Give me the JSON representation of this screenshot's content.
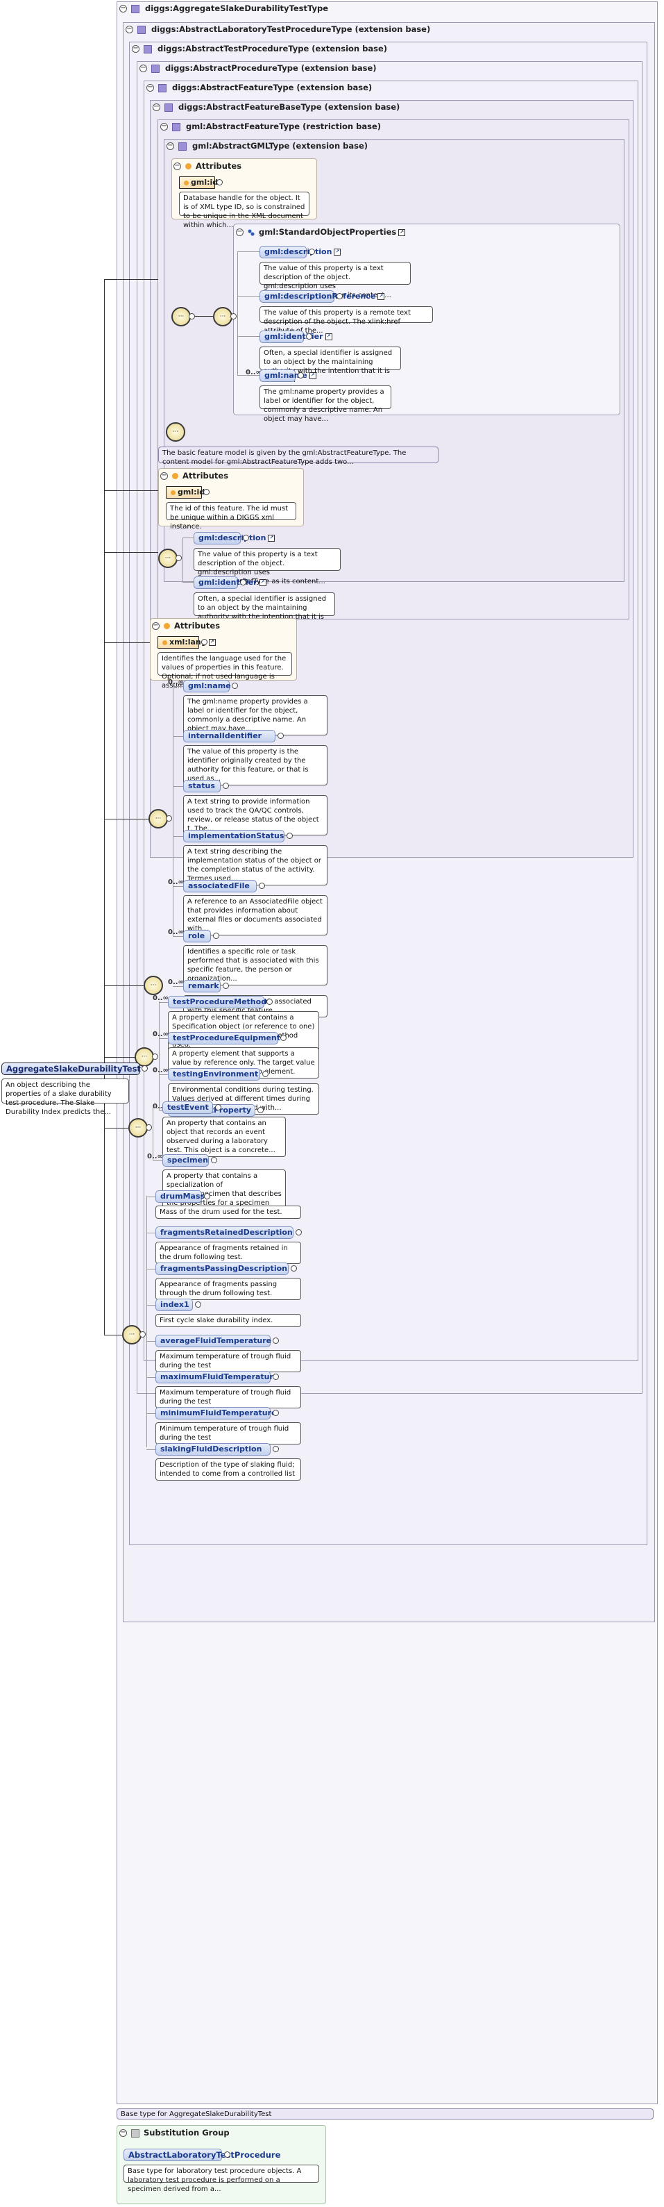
{
  "types": {
    "root": "diggs:AggregateSlakeDurabilityTestType",
    "alt": "diggs:AbstractLaboratoryTestProcedureType (extension base)",
    "atp": "diggs:AbstractTestProcedureType (extension base)",
    "ap": "diggs:AbstractProcedureType (extension base)",
    "af": "diggs:AbstractFeatureType (extension base)",
    "afb": "diggs:AbstractFeatureBaseType (extension base)",
    "gaf": "gml:AbstractFeatureType (restriction base)",
    "gml": "gml:AbstractGMLType (extension base)"
  },
  "attributes_label": "Attributes",
  "gml_attrs": {
    "gml_id": "gml:id",
    "gml_id_desc": "Database handle for the object. It is of XML type ID, so is constrained to be unique in the XML document within which..."
  },
  "standard_props": {
    "group": "gml:StandardObjectProperties",
    "items": [
      {
        "name": "gml:description",
        "desc": "The value of this property is a text description of the object. gml:description uses gml:StringOrRefType as its content..."
      },
      {
        "name": "gml:descriptionReference",
        "desc": "The value of this property is a remote text description of the object. The xlink:href attribute of the..."
      },
      {
        "name": "gml:identifier",
        "desc": "Often, a special identifier is assigned to an object by the maintaining authority with the intention that it is used in..."
      },
      {
        "name": "gml:name",
        "card": "0..∞",
        "desc": "The gml:name property provides a label or identifier for the object, commonly a descriptive name. An object may have..."
      }
    ]
  },
  "gaf_desc": "The basic feature model is given by the gml:AbstractFeatureType. The content model for gml:AbstractFeatureType adds two...",
  "afb_attrs": {
    "gml_id": "gml:id",
    "gml_id_desc": "The id of this feature. The id must be unique within a DIGGS xml instance."
  },
  "afb_elems": [
    {
      "name": "gml:description",
      "desc": "The value of this property is a text description of the object. gml:description uses gml:StringOrRefType as its content..."
    },
    {
      "name": "gml:identifier",
      "desc": "Often, a special identifier is assigned to an object by the maintaining authority with the intention that it is used in..."
    }
  ],
  "af_attrs": {
    "xml_lang": "xml:lang",
    "xml_lang_desc": "Identifies the language used for the values of properties in this feature. Optional; if not used language is assumed to..."
  },
  "af_elems": [
    {
      "name": "gml:name",
      "card": "0..∞",
      "desc": "The gml:name property provides a label or identifier for the object, commonly a descriptive name. An object may have..."
    },
    {
      "name": "internalIdentifier",
      "card": "",
      "desc": "The value of this property is the identifier originally created by the authority for this feature, or that is used as..."
    },
    {
      "name": "status",
      "card": "",
      "desc": "A text string to provide information used to track the QA/QC controls, review, or release status of the object t. The..."
    },
    {
      "name": "implementationStatus",
      "card": "",
      "desc": "A text string describing the implementation status of the object or the completion status of the activity. Termes used..."
    },
    {
      "name": "associatedFile",
      "card": "0..∞",
      "desc": "A reference to an AssociatedFile object that provides information about external files or documents associated with..."
    },
    {
      "name": "role",
      "card": "0..∞",
      "desc": "Identifies a specific role or task performed that is associated with this specific feature, the person or organization..."
    },
    {
      "name": "remark",
      "card": "0..∞",
      "desc": "Any comment or remark associated with this specific feature."
    }
  ],
  "atp_elems": [
    {
      "name": "testProcedureMethod",
      "card": "0..∞",
      "desc": "A property element that contains a Specification object (or reference to one) detailing the test procedure method used."
    },
    {
      "name": "testProcedureEquipment",
      "card": "0..∞",
      "desc": "A property element that supports a value by reference only. The target value is indicated in the xppinfo element."
    },
    {
      "name": "testingEnvironment",
      "card": "0..∞",
      "desc": "Environmental conditions during testing. Values derived at different times during the test can be specified with..."
    },
    {
      "name": "otherTestProperty",
      "card": "0..∞",
      "desc": ""
    }
  ],
  "alt_elems": [
    {
      "name": "testEvent",
      "card": "",
      "desc": "An property that contains an object that records an event observed during a laboratory test. This object is a concrete..."
    },
    {
      "name": "specimen",
      "card": "0..∞",
      "desc": "A property that contains a specialization of AbstractSpecimen that describes the properties for a specimen used in the..."
    }
  ],
  "root_elems": [
    {
      "name": "drumMass",
      "desc": "Mass of the drum used for the test."
    },
    {
      "name": "fragmentsRetainedDescription",
      "desc": "Appearance of fragments retained in the drum following test."
    },
    {
      "name": "fragmentsPassingDescription",
      "desc": "Appearance of fragments passing through the drum following test."
    },
    {
      "name": "index1",
      "desc": "First cycle slake durability index."
    },
    {
      "name": "averageFluidTemperature",
      "desc": "Maximum temperature of trough fluid during the test"
    },
    {
      "name": "maximumFluidTemperature",
      "desc": "Maximum temperature of trough fluid during the test"
    },
    {
      "name": "minimumFluidTemperature",
      "desc": "Minimum temperature of trough fluid during the test"
    },
    {
      "name": "slakingFluidDescription",
      "desc": "Description of the type of slaking fluid; intended to come from a controlled list"
    }
  ],
  "main_element": {
    "name": "AggregateSlakeDurabilityTest",
    "desc": "An object describing the properties of a slake durability test procedure. The Slake Durability Index predicts the..."
  },
  "base_type_desc": "Base type for AggregateSlakeDurabilityTest",
  "substitution": {
    "label": "Substitution Group",
    "name": "AbstractLaboratoryTestProcedure",
    "desc": "Base type for laboratory test procedure objects. A laboratory test procedure is performed on a specimen derived from a..."
  }
}
